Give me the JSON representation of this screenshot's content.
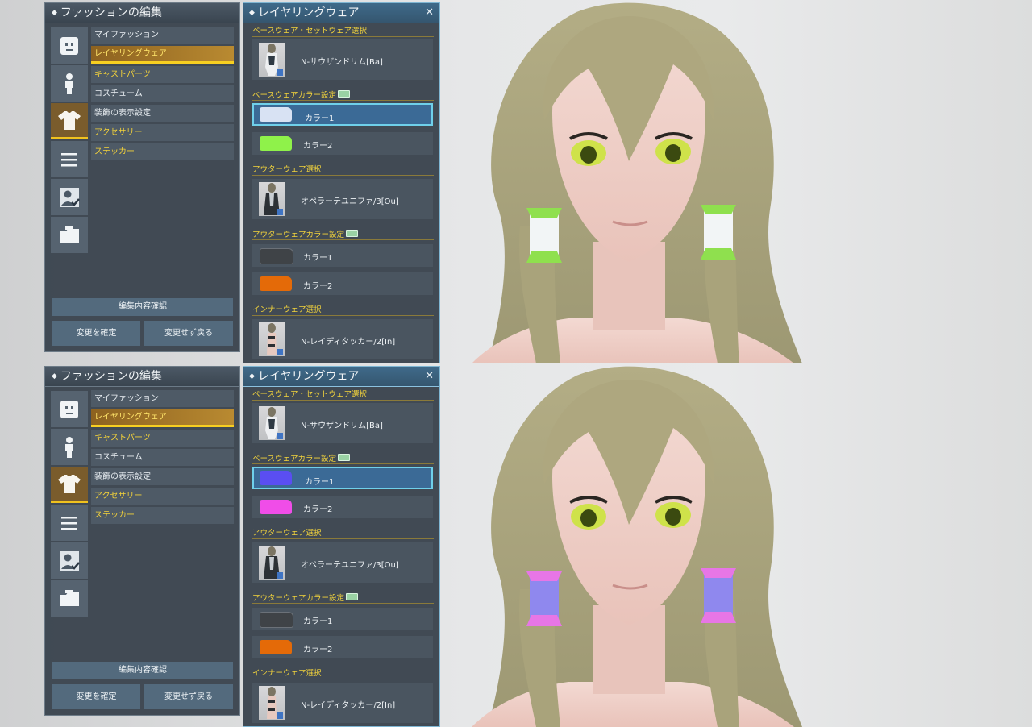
{
  "screens": [
    {
      "fashion": {
        "title": "ファッションの編集",
        "menu": [
          "マイファッション",
          "レイヤリングウェア",
          "キャストパーツ",
          "コスチューム",
          "装飾の表示設定",
          "アクセサリー",
          "ステッカー"
        ],
        "confirm_label": "編集内容確認",
        "ok_label": "変更を確定",
        "back_label": "変更せず戻る"
      },
      "layering": {
        "title": "レイヤリングウェア",
        "base_section": "ベースウェア・セットウェア選択",
        "base_item": "N-サウザンドリム[Ba]",
        "base_color_section": "ベースウェアカラー設定",
        "base_colors": [
          {
            "label": "カラー1",
            "color": "#d8e2f3"
          },
          {
            "label": "カラー2",
            "color": "#8ff24a"
          }
        ],
        "outer_section": "アウターウェア選択",
        "outer_item": "オペラーテユニファ/3[Ou]",
        "outer_color_section": "アウターウェアカラー設定",
        "outer_colors": [
          {
            "label": "カラー1",
            "color": "#3f4347"
          },
          {
            "label": "カラー2",
            "color": "#e46a08"
          }
        ],
        "inner_section": "インナーウェア選択",
        "inner_item": "N-レイディタッカー/2[In]"
      },
      "accessory_colors": {
        "primary": "#f2f5f6",
        "secondary": "#8fe04e"
      }
    },
    {
      "fashion": {
        "title": "ファッションの編集",
        "menu": [
          "マイファッション",
          "レイヤリングウェア",
          "キャストパーツ",
          "コスチューム",
          "装飾の表示設定",
          "アクセサリー",
          "ステッカー"
        ],
        "confirm_label": "編集内容確認",
        "ok_label": "変更を確定",
        "back_label": "変更せず戻る"
      },
      "layering": {
        "title": "レイヤリングウェア",
        "base_section": "ベースウェア・セットウェア選択",
        "base_item": "N-サウザンドリム[Ba]",
        "base_color_section": "ベースウェアカラー設定",
        "base_colors": [
          {
            "label": "カラー1",
            "color": "#5a4ef2"
          },
          {
            "label": "カラー2",
            "color": "#f04de8"
          }
        ],
        "outer_section": "アウターウェア選択",
        "outer_item": "オペラーテユニファ/3[Ou]",
        "outer_color_section": "アウターウェアカラー設定",
        "outer_colors": [
          {
            "label": "カラー1",
            "color": "#3f4347"
          },
          {
            "label": "カラー2",
            "color": "#e46a08"
          }
        ],
        "inner_section": "インナーウェア選択",
        "inner_item": "N-レイディタッカー/2[In]"
      },
      "accessory_colors": {
        "primary": "#8f88ee",
        "secondary": "#e776e6"
      }
    }
  ]
}
